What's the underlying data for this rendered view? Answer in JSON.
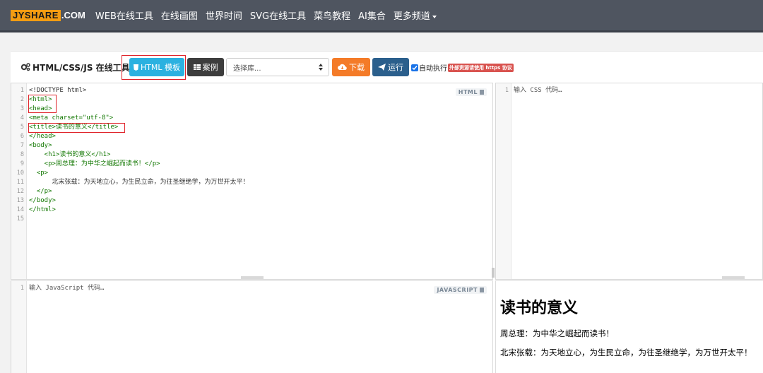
{
  "nav": {
    "logo_mark": "JYSHARE",
    "logo_domain": ".COM",
    "links": [
      "WEB在线工具",
      "在线画图",
      "世界时间",
      "SVG在线工具",
      "菜鸟教程",
      "AI集合",
      "更多频道"
    ]
  },
  "toolbar": {
    "title": "HTML/CSS/JS 在线工具",
    "template_label": "HTML 模板",
    "example_label": "案例",
    "select_value": "选择库...",
    "download_label": "下载",
    "run_label": "运行",
    "auto_label": "自动执行",
    "https_notice": "外部资源请使用 https 协议"
  },
  "html_editor": {
    "label": "HTML",
    "line_numbers": [
      "1",
      "2",
      "3",
      "4",
      "5",
      "6",
      "7",
      "8",
      "9",
      "10",
      "11",
      "12",
      "13",
      "14",
      "15"
    ],
    "lines": [
      "<!DOCTYPE html>",
      "<html>",
      "<head>",
      "<meta charset=\"utf-8\">",
      "<title>读书的意义</title>",
      "</head>",
      "<body>",
      "    <h1>读书的意义</h1>",
      "    <p>周总理：为中华之崛起而读书！</p>",
      "  <p>",
      "      北宋张载：为天地立心，为生民立命，为往圣继绝学，为万世开太平！",
      "  </p>",
      "</body>",
      "</html>",
      ""
    ]
  },
  "css_editor": {
    "line_numbers": [
      "1"
    ],
    "placeholder": "输入 CSS 代码…"
  },
  "js_editor": {
    "label": "JAVASCRIPT",
    "line_numbers": [
      "1"
    ],
    "placeholder": "输入 JavaScript 代码…"
  },
  "preview": {
    "heading": "读书的意义",
    "p1": "周总理：为中华之崛起而读书！",
    "p2": "北宋张载：为天地立心，为生民立命，为往圣继绝学，为万世开太平！"
  },
  "colors": {
    "nav_bg": "#4f5560",
    "template_btn": "#2bb1e0",
    "download_btn": "#f47b28",
    "run_btn": "#2b5f8c",
    "highlight": "#e0242b"
  }
}
